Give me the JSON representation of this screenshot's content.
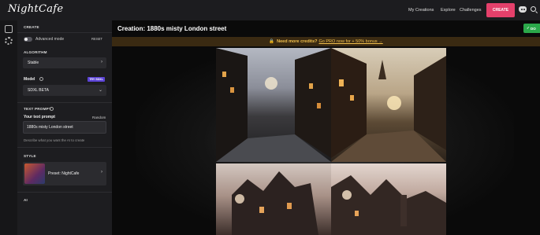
{
  "app": {
    "logo": "NightCafe"
  },
  "nav": {
    "my_creations": "My Creations",
    "explore": "Explore",
    "challenges": "Challenges",
    "create": "CREATE"
  },
  "sidebar": {
    "section_create": "CREATE",
    "advanced_mode": "Advanced mode",
    "reset": "RESET",
    "algorithm_label": "ALGORITHM",
    "algorithm_value": "Stable",
    "model_label": "Model",
    "model_badge": "TRY SDXL",
    "model_value": "SDXL BETA",
    "text_prompt_label": "TEXT PROMPT",
    "your_prompt_label": "Your text prompt",
    "random": "Random",
    "prompt_value": "1880s misty London street",
    "prompt_hint": "Describe what you want the AI to create",
    "style_label": "STYLE",
    "style_value": "Preset: NightCafe",
    "ai_label": "AI"
  },
  "main": {
    "title": "Creation: 1880s misty London street",
    "done": "DO",
    "banner_bold": "Need more credits?",
    "banner_link": "Go PRO now for + 50% bonus →"
  },
  "icons": [
    "discord-icon",
    "search-icon",
    "create-icon",
    "settings-icon"
  ],
  "colors": {
    "accent": "#e5406b",
    "badge": "#5b43d6",
    "done": "#2ba84a",
    "banner_text": "#f3c14c"
  }
}
